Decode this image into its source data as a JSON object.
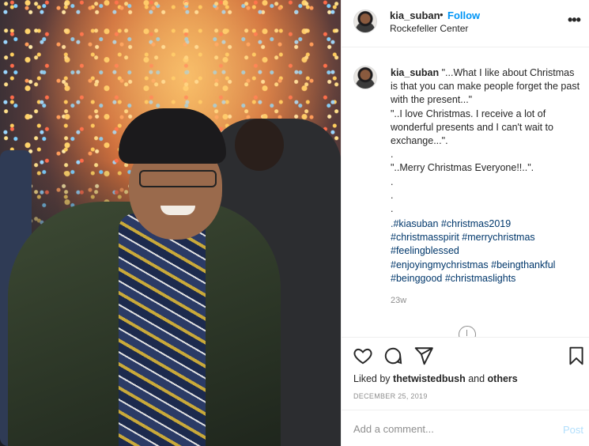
{
  "post": {
    "username": "kia_suban",
    "separator": "•",
    "follow_label": "Follow",
    "location": "Rockefeller Center",
    "more_label": "•••"
  },
  "caption": {
    "username": "kia_suban",
    "lines": [
      "\"...What I like about Christmas is that you can make people forget the past with the present...\"",
      "\"..I love Christmas. I receive a lot of wonderful presents and I can't wait to exchange...\".",
      ".",
      "\"..Merry Christmas Everyone!!..\".",
      ".",
      ".",
      "."
    ],
    "hashtags": [
      ".#kiasuban #christmas2019",
      "#christmasspirit #merrychristmas",
      "#feelingblessed",
      "#enjoyingmychristmas #beingthankful",
      "#beinggood #christmaslights"
    ],
    "time": "23w"
  },
  "actions": {
    "liked_by_prefix": "Liked by",
    "liked_by_user": "thetwistedbush",
    "liked_by_and": "and",
    "liked_by_others": "others",
    "date": "DECEMBER 25, 2019"
  },
  "comment": {
    "placeholder": "Add a comment...",
    "post_label": "Post"
  },
  "colors": {
    "link_blue": "#0095f6",
    "hashtag_blue": "#00376b",
    "muted_gray": "#8e8e8e",
    "post_disabled": "#b2dffc"
  },
  "icons": [
    "heart-icon",
    "comment-icon",
    "share-icon",
    "bookmark-icon",
    "more-icon",
    "loading-icon"
  ]
}
